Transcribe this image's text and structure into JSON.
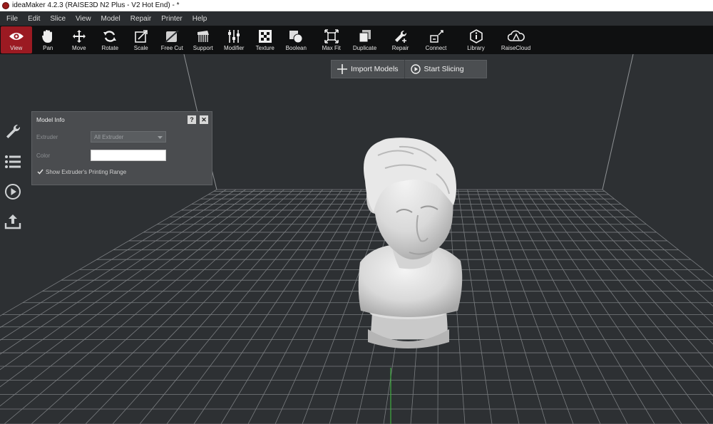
{
  "window": {
    "title": "ideaMaker 4.2.3 (RAISE3D N2 Plus - V2 Hot End) - *"
  },
  "menu": [
    "File",
    "Edit",
    "Slice",
    "View",
    "Model",
    "Repair",
    "Printer",
    "Help"
  ],
  "toolbar": [
    {
      "label": "View",
      "icon": "eye-icon",
      "active": true
    },
    {
      "label": "Pan",
      "icon": "hand-icon"
    },
    {
      "label": "Move",
      "icon": "move-icon"
    },
    {
      "label": "Rotate",
      "icon": "rotate-icon"
    },
    {
      "label": "Scale",
      "icon": "scale-icon"
    },
    {
      "label": "Free Cut",
      "icon": "free-cut-icon"
    },
    {
      "label": "Support",
      "icon": "support-icon"
    },
    {
      "label": "Modifier",
      "icon": "modifier-icon"
    },
    {
      "label": "Texture",
      "icon": "texture-icon"
    },
    {
      "label": "Boolean",
      "icon": "boolean-icon"
    },
    {
      "label": "Max Fit",
      "icon": "max-fit-icon"
    },
    {
      "label": "Duplicate",
      "icon": "duplicate-icon"
    },
    {
      "label": "Repair",
      "icon": "repair-icon"
    },
    {
      "label": "Connect",
      "icon": "connect-icon"
    },
    {
      "label": "Library",
      "icon": "library-icon"
    },
    {
      "label": "RaiseCloud",
      "icon": "cloud-icon"
    }
  ],
  "actions": {
    "import_label": "Import Models",
    "slice_label": "Start Slicing"
  },
  "side_tools": [
    "wrench-icon",
    "list-icon",
    "play-circle-icon",
    "upload-icon"
  ],
  "model_info": {
    "title": "Model Info",
    "help_label": "?",
    "close_label": "✕",
    "extruder_label": "Extruder",
    "extruder_value": "All Extruder",
    "color_label": "Color",
    "color_value": "#ffffff",
    "show_range_label": "Show Extruder's Printing Range",
    "show_range_checked": true
  },
  "colors": {
    "accent": "#9b1a22",
    "viewport_bg": "#2d3033",
    "grid": "#8a8d90"
  }
}
